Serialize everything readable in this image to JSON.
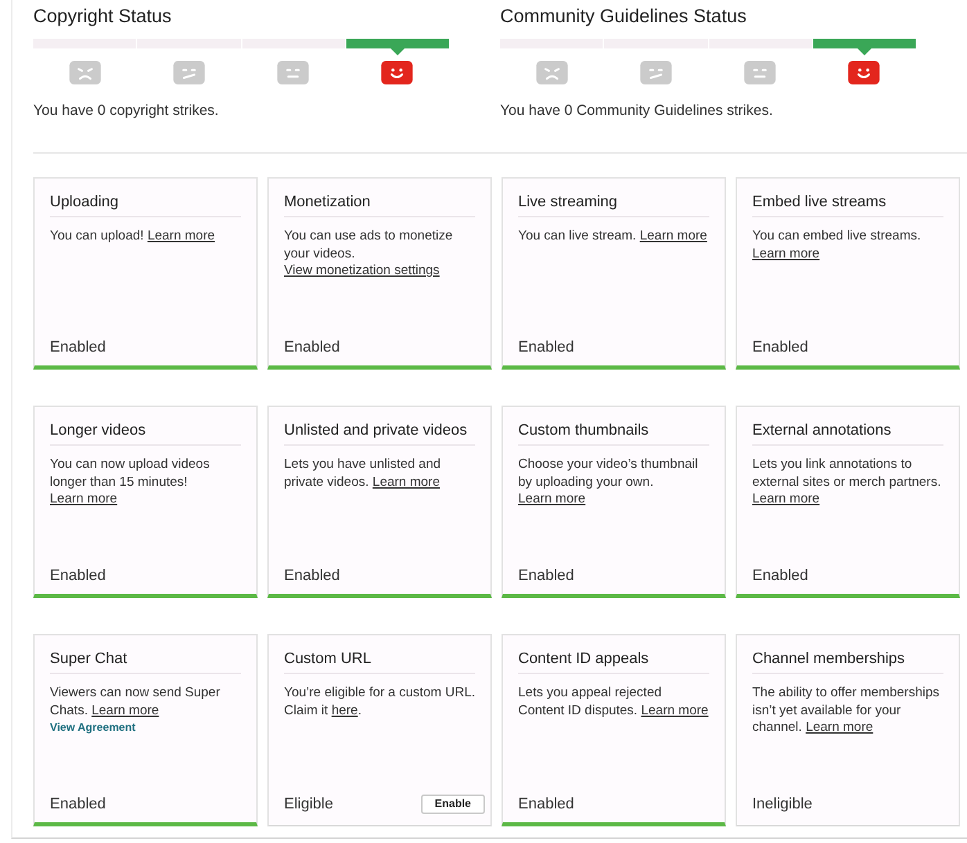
{
  "status_panels": [
    {
      "title": "Copyright Status",
      "levels": [
        {
          "kind": "sad",
          "selected": false
        },
        {
          "kind": "uneasy",
          "selected": false
        },
        {
          "kind": "neutral",
          "selected": false
        },
        {
          "kind": "happy",
          "selected": true
        }
      ],
      "message": "You have 0 copyright strikes."
    },
    {
      "title": "Community Guidelines Status",
      "levels": [
        {
          "kind": "sad",
          "selected": false
        },
        {
          "kind": "uneasy",
          "selected": false
        },
        {
          "kind": "neutral",
          "selected": false
        },
        {
          "kind": "happy",
          "selected": true
        }
      ],
      "message": "You have 0 Community Guidelines strikes."
    }
  ],
  "features": [
    {
      "title": "Uploading",
      "description": [
        {
          "kind": "text",
          "text": "You can upload! "
        },
        {
          "kind": "link",
          "text": "Learn more"
        }
      ],
      "status": "Enabled",
      "enabled": true
    },
    {
      "title": "Monetization",
      "description": [
        {
          "kind": "text",
          "text": "You can use ads to monetize your videos. "
        },
        {
          "kind": "link",
          "text": "View monetization settings"
        }
      ],
      "status": "Enabled",
      "enabled": true
    },
    {
      "title": "Live streaming",
      "description": [
        {
          "kind": "text",
          "text": "You can live stream. "
        },
        {
          "kind": "link",
          "text": "Learn more"
        }
      ],
      "status": "Enabled",
      "enabled": true
    },
    {
      "title": "Embed live streams",
      "description": [
        {
          "kind": "text",
          "text": "You can embed live streams. "
        },
        {
          "kind": "link",
          "text": "Learn more"
        }
      ],
      "status": "Enabled",
      "enabled": true
    },
    {
      "title": "Longer videos",
      "description": [
        {
          "kind": "text",
          "text": "You can now upload videos longer than 15 minutes! "
        },
        {
          "kind": "link",
          "text": "Learn more"
        }
      ],
      "status": "Enabled",
      "enabled": true
    },
    {
      "title": "Unlisted and private videos",
      "description": [
        {
          "kind": "text",
          "text": "Lets you have unlisted and private videos. "
        },
        {
          "kind": "link",
          "text": "Learn more"
        }
      ],
      "status": "Enabled",
      "enabled": true
    },
    {
      "title": "Custom thumbnails",
      "description": [
        {
          "kind": "text",
          "text": "Choose your video’s thumbnail by uploading your own. "
        },
        {
          "kind": "link",
          "text": "Learn more"
        }
      ],
      "status": "Enabled",
      "enabled": true
    },
    {
      "title": "External annotations",
      "description": [
        {
          "kind": "text",
          "text": "Lets you link annotations to external sites or merch partners. "
        },
        {
          "kind": "link",
          "text": "Learn more"
        }
      ],
      "status": "Enabled",
      "enabled": true
    },
    {
      "title": "Super Chat",
      "description": [
        {
          "kind": "text",
          "text": "Viewers can now send Super Chats. "
        },
        {
          "kind": "link",
          "text": "Learn more"
        }
      ],
      "extra_link": "View Agreement",
      "status": "Enabled",
      "enabled": true
    },
    {
      "title": "Custom URL",
      "description": [
        {
          "kind": "text",
          "text": "You’re eligible for a custom URL. Claim it "
        },
        {
          "kind": "link",
          "text": "here"
        },
        {
          "kind": "text",
          "text": "."
        }
      ],
      "status": "Eligible",
      "enabled": false,
      "action": "Enable"
    },
    {
      "title": "Content ID appeals",
      "description": [
        {
          "kind": "text",
          "text": "Lets you appeal rejected Content ID disputes. "
        },
        {
          "kind": "link",
          "text": "Learn more"
        }
      ],
      "status": "Enabled",
      "enabled": true
    },
    {
      "title": "Channel memberships",
      "description": [
        {
          "kind": "text",
          "text": "The ability to offer memberships isn’t yet available for your channel. "
        },
        {
          "kind": "link",
          "text": "Learn more"
        }
      ],
      "status": "Ineligible",
      "enabled": false
    }
  ]
}
